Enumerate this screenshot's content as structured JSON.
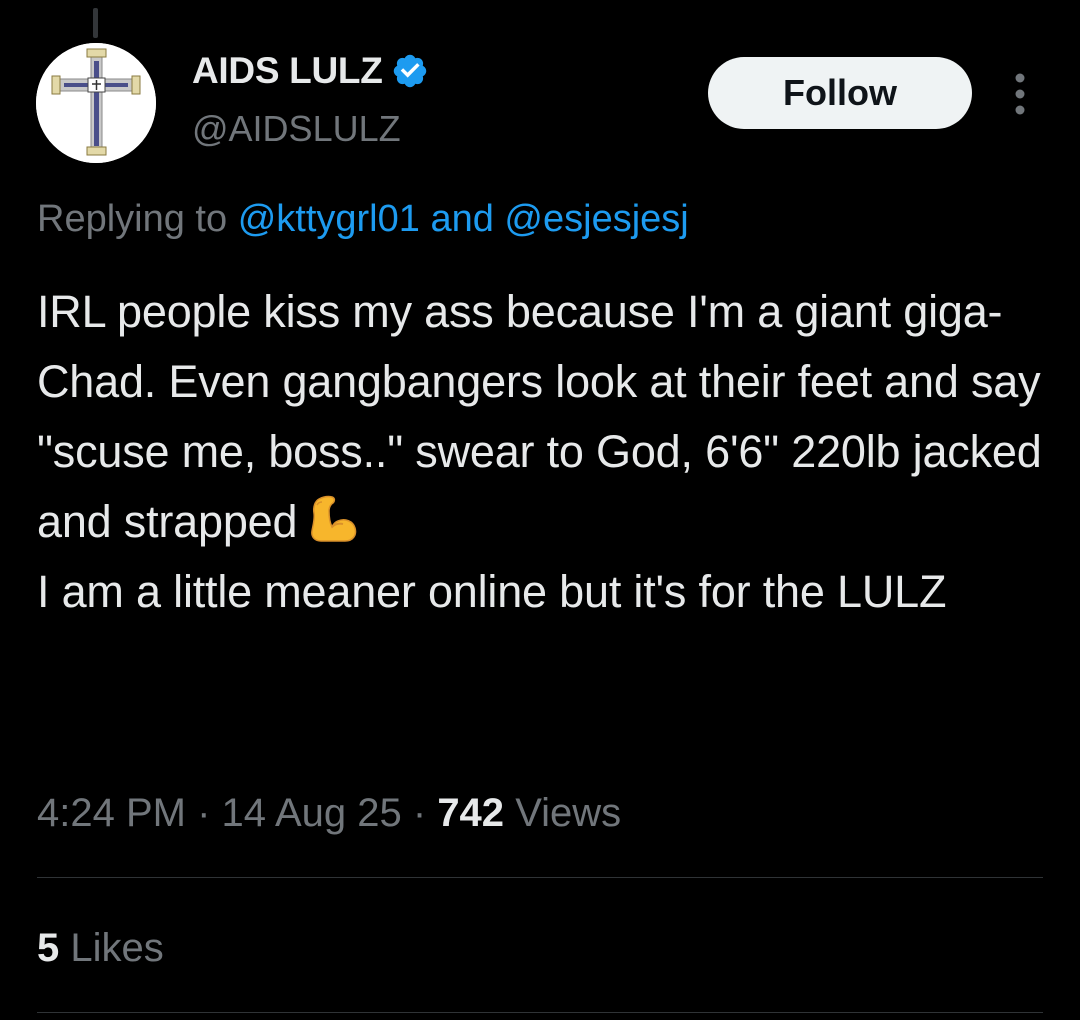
{
  "author": {
    "display_name": "AIDS LULZ",
    "handle": "@AIDSLULZ",
    "verified_icon": "verified-badge-icon",
    "verified_color": "#1d9bf0"
  },
  "follow_button": {
    "label": "Follow"
  },
  "more_menu": {
    "icon": "more-vertical-icon"
  },
  "reply_context": {
    "prefix": "Replying to",
    "mention_1": "@kttygrl01",
    "joiner": "and",
    "mention_2": "@esjesjesj"
  },
  "tweet": {
    "text_part1": "IRL people kiss my ass because I'm a giant giga-Chad. Even gangbangers look at their feet and say \"scuse me, boss..\" swear to God, 6'6\" 220lb jacked and strapped",
    "emoji": "flexed-biceps-emoji",
    "text_part2": "I am a little meaner online but it's for the LULZ"
  },
  "meta": {
    "time": "4:24 PM",
    "separator": "·",
    "date": "14 Aug 25",
    "views_count": "742",
    "views_label": "Views"
  },
  "stats": {
    "likes_count": "5",
    "likes_label": "Likes"
  },
  "colors": {
    "background": "#000000",
    "text_primary": "#e7e9ea",
    "text_secondary": "#71767b",
    "link": "#1d9bf0",
    "divider": "#2f3336"
  }
}
